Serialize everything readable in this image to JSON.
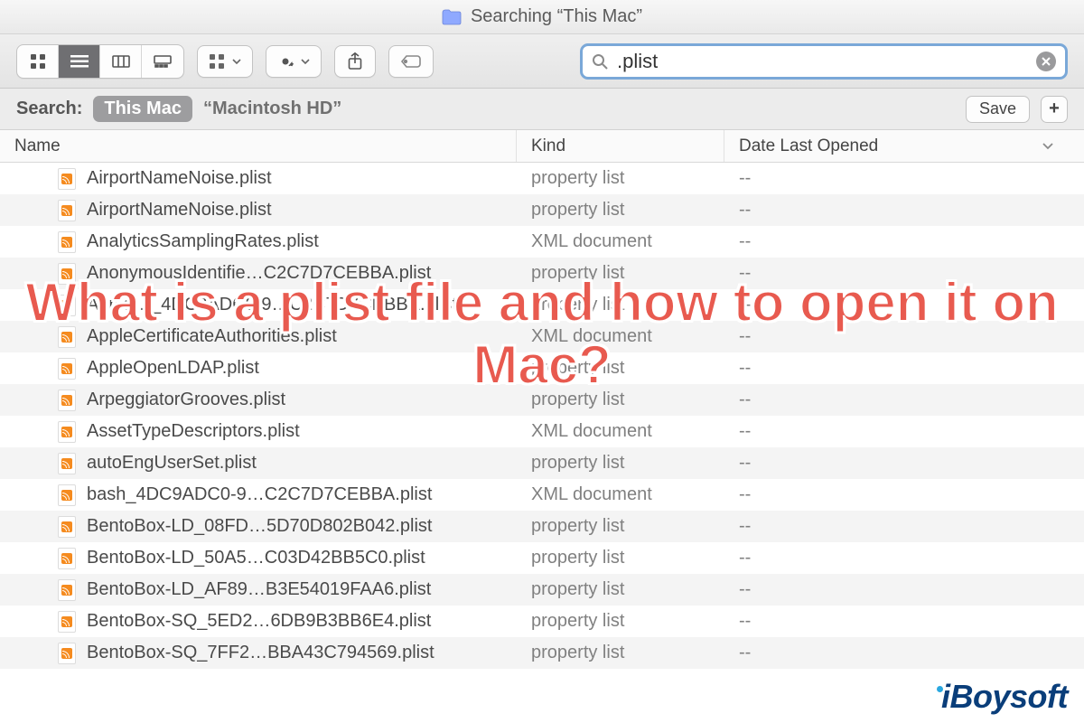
{
  "window": {
    "title": "Searching “This Mac”"
  },
  "toolbar": {
    "view_modes": [
      "icon",
      "list",
      "column",
      "gallery"
    ],
    "active_view_index": 1,
    "search_value": ".plist"
  },
  "scope": {
    "label": "Search:",
    "active_scope": "This Mac",
    "other_scope": "“Macintosh HD”",
    "save_label": "Save"
  },
  "columns": {
    "name": "Name",
    "kind": "Kind",
    "date": "Date Last Opened"
  },
  "rows": [
    {
      "name": "AirportNameNoise.plist",
      "kind": "property list",
      "date": "--"
    },
    {
      "name": "AirportNameNoise.plist",
      "kind": "property list",
      "date": "--"
    },
    {
      "name": "AnalyticsSamplingRates.plist",
      "kind": "XML document",
      "date": "--"
    },
    {
      "name": "AnonymousIdentifie…C2C7D7CEBBA.plist",
      "kind": "property list",
      "date": "--"
    },
    {
      "name": "Apple…_4DC9ADC0-9…C2C7D7CEBBA.plist",
      "kind": "property list",
      "date": "--"
    },
    {
      "name": "AppleCertificateAuthorities.plist",
      "kind": "XML document",
      "date": "--"
    },
    {
      "name": "AppleOpenLDAP.plist",
      "kind": "property list",
      "date": "--"
    },
    {
      "name": "ArpeggiatorGrooves.plist",
      "kind": "property list",
      "date": "--"
    },
    {
      "name": "AssetTypeDescriptors.plist",
      "kind": "XML document",
      "date": "--"
    },
    {
      "name": "autoEngUserSet.plist",
      "kind": "property list",
      "date": "--"
    },
    {
      "name": "bash_4DC9ADC0-9…C2C7D7CEBBA.plist",
      "kind": "XML document",
      "date": "--"
    },
    {
      "name": "BentoBox-LD_08FD…5D70D802B042.plist",
      "kind": "property list",
      "date": "--"
    },
    {
      "name": "BentoBox-LD_50A5…C03D42BB5C0.plist",
      "kind": "property list",
      "date": "--"
    },
    {
      "name": "BentoBox-LD_AF89…B3E54019FAA6.plist",
      "kind": "property list",
      "date": "--"
    },
    {
      "name": "BentoBox-SQ_5ED2…6DB9B3BB6E4.plist",
      "kind": "property list",
      "date": "--"
    },
    {
      "name": "BentoBox-SQ_7FF2…BBA43C794569.plist",
      "kind": "property list",
      "date": "--"
    }
  ],
  "overlay": {
    "headline": "What is a plist file and how to open it on Mac?"
  },
  "watermark": {
    "text": "iBoysoft"
  }
}
